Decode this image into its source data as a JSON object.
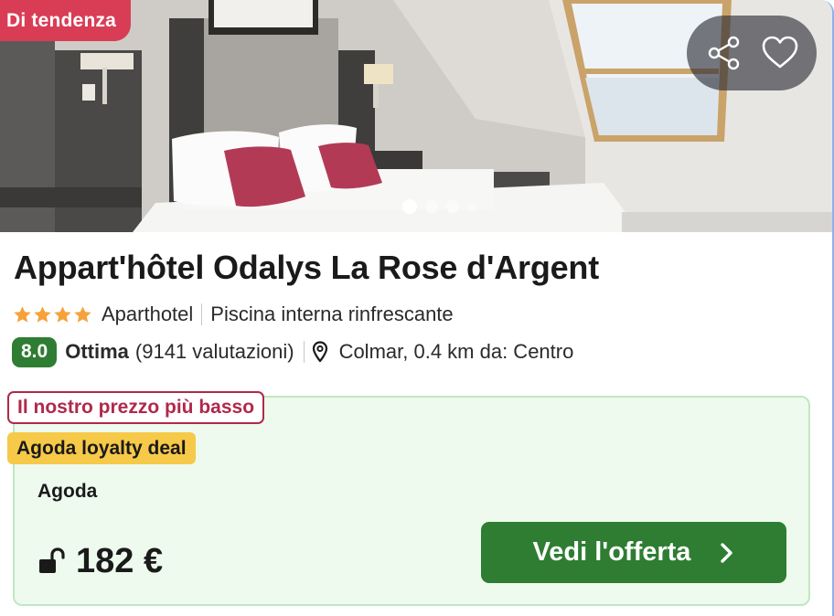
{
  "photo": {
    "badge": "Di tendenza",
    "share_icon": "share-icon",
    "favorite_icon": "heart-icon",
    "carousel": {
      "current_index": 0
    }
  },
  "hotel": {
    "name": "Appart'hôtel Odalys La Rose d'Argent",
    "stars": 4,
    "type": "Aparthotel",
    "feature": "Piscina interna rinfrescante",
    "score": "8.0",
    "rating_word": "Ottima",
    "reviews": "(9141 valutazioni)",
    "location": "Colmar, 0.4 km da: Centro"
  },
  "deal": {
    "lowest_price_label": "Il nostro prezzo più basso",
    "loyalty_label": "Agoda loyalty deal",
    "provider": "Agoda",
    "price": "182 €",
    "cta_label": "Vedi l'offerta"
  },
  "colors": {
    "badge_red": "#d93d56",
    "score_green": "#2e7d32",
    "deal_bg": "#edfaed",
    "loyalty_yellow": "#f7c948",
    "lowest_label_red": "#b0294a",
    "star_orange": "#f5a23a"
  }
}
